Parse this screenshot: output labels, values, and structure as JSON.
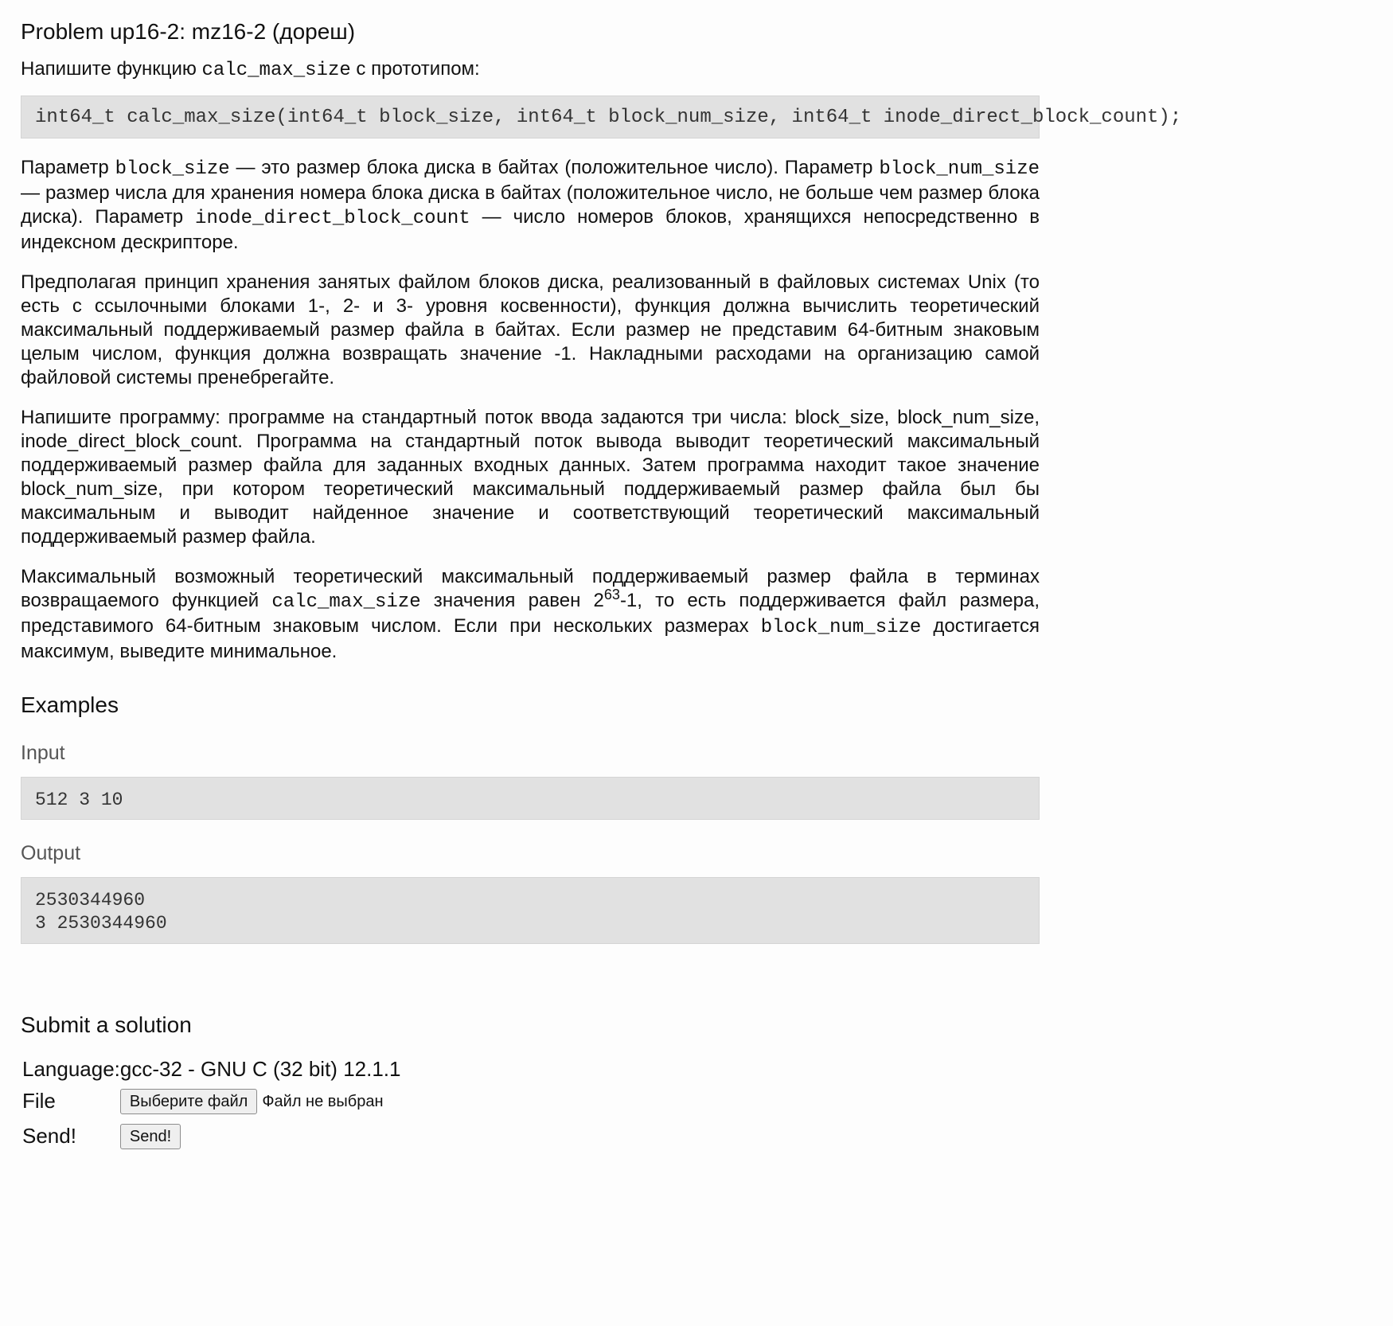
{
  "problem": {
    "title": "Problem up16-2: mz16-2 (дореш)"
  },
  "statement": {
    "intro_prefix": "Напишите функцию ",
    "intro_func": "calc_max_size",
    "intro_suffix": " с прототипом:",
    "prototype": "int64_t calc_max_size(int64_t block_size, int64_t block_num_size, int64_t inode_direct_block_count);",
    "p1": {
      "t1": "Параметр ",
      "c1": "block_size",
      "t2": " — это размер блока диска в байтах (положительное число). Параметр ",
      "c2": "block_num_size",
      "t3": " — размер числа для хранения номера блока диска в байтах (положительное число, не больше чем размер блока диска). Параметр ",
      "c3": "inode_direct_block_count",
      "t4": " — число номеров блоков, хранящихся непосредственно в индексном дескрипторе."
    },
    "p2": "Предполагая принцип хранения занятых файлом блоков диска, реализованный в файловых системах Unix (то есть с ссылочными блоками 1-, 2- и 3- уровня косвенности), функция должна вычислить теоретический максимальный поддерживаемый размер файла в байтах. Если размер не представим 64-битным знаковым целым числом, функция должна возвращать значение -1. Накладными расходами на организацию самой файловой системы пренебрегайте.",
    "p3": "Напишите программу: программе на стандартный поток ввода задаются три числа: block_size, block_num_size, inode_direct_block_count. Программа на стандартный поток вывода выводит теоретический максимальный поддерживаемый размер файла для заданных входных данных. Затем программа находит такое значение block_num_size, при котором теоретический максимальный поддерживаемый размер файла был бы максимальным и выводит найденное значение и соответствующий теоретический максимальный поддерживаемый размер файла.",
    "p4": {
      "t1": "Максимальный возможный теоретический максимальный поддерживаемый размер файла в терминах возвращаемого функцией ",
      "c1": "calc_max_size",
      "t2": " значения равен 2",
      "sup": "63",
      "t3": "-1, то есть поддерживается файл размера, представимого 64-битным знаковым числом. Если при нескольких размерах ",
      "c2": "block_num_size",
      "t4": " достигается максимум, выведите минимальное."
    }
  },
  "examples": {
    "heading": "Examples",
    "input_label": "Input",
    "input_value": "512 3 10",
    "output_label": "Output",
    "output_lines": [
      "2530344960",
      "3 2530344960"
    ]
  },
  "submit": {
    "heading": "Submit a solution",
    "language_label": "Language:",
    "language_value": "gcc-32 - GNU C (32 bit) 12.1.1",
    "file_label": "File",
    "file_button": "Выберите файл",
    "file_status": "Файл не выбран",
    "send_label": "Send!",
    "send_button": "Send!"
  }
}
